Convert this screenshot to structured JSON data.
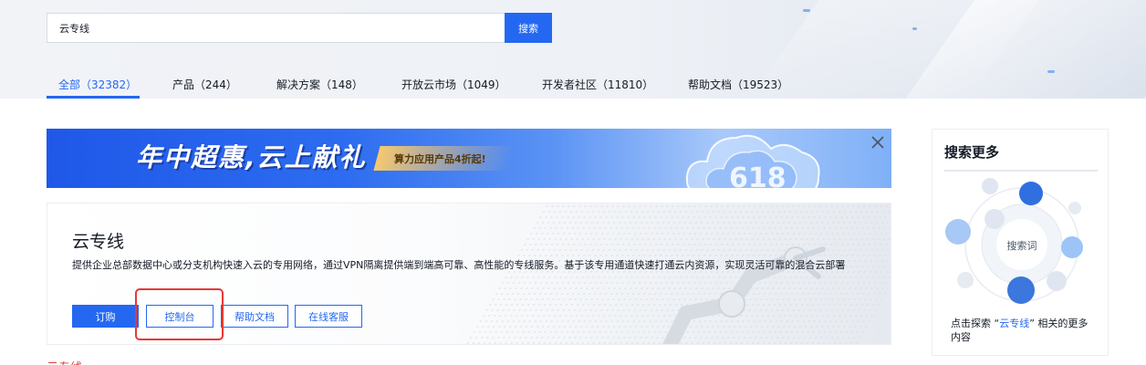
{
  "search": {
    "value": "云专线",
    "button_label": "搜索"
  },
  "tabs": [
    {
      "label": "全部（32382）",
      "active": true
    },
    {
      "label": "产品（244）",
      "active": false
    },
    {
      "label": "解决方案（148）",
      "active": false
    },
    {
      "label": "开放云市场（1049）",
      "active": false
    },
    {
      "label": "开发者社区（11810）",
      "active": false
    },
    {
      "label": "帮助文档（19523）",
      "active": false
    }
  ],
  "banner": {
    "title": "年中超惠,云上献礼",
    "tag": "算力应用产品4折起!",
    "badge": "618"
  },
  "product": {
    "title": "云专线",
    "description": "提供企业总部数据中心或分支机构快速入云的专用网络，通过VPN隔离提供端到端高可靠、高性能的专线服务。基于该专用通道快速打通云内资源，实现灵活可靠的混合云部署",
    "buttons": {
      "order": "订购",
      "console": "控制台",
      "docs": "帮助文档",
      "service": "在线客服"
    }
  },
  "result_title": "云专线",
  "sidebar": {
    "title": "搜索更多",
    "center_label": "搜索词",
    "foot_prefix": "点击探索 “",
    "foot_keyword": "云专线",
    "foot_suffix": "” 相关的更多内容"
  },
  "colors": {
    "primary": "#2468f2",
    "highlight": "#e53935",
    "text": "#151b26"
  }
}
